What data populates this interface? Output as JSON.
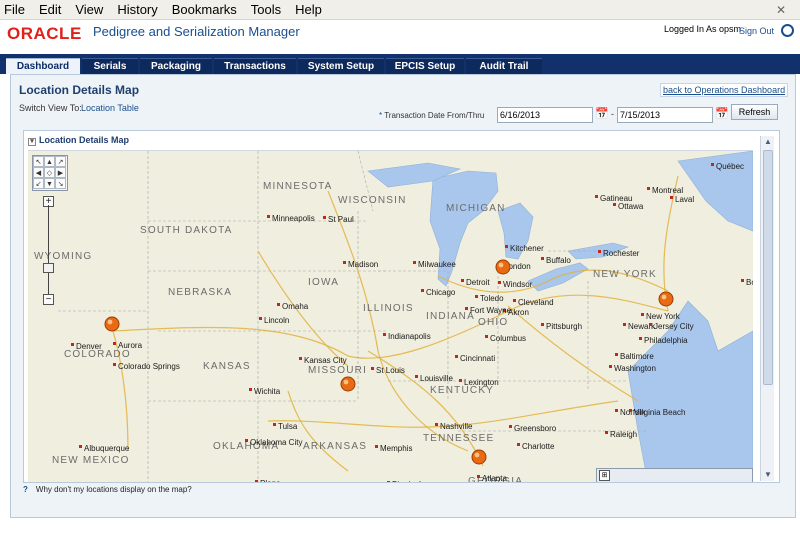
{
  "menubar": {
    "items": [
      "File",
      "Edit",
      "View",
      "History",
      "Bookmarks",
      "Tools",
      "Help"
    ]
  },
  "header": {
    "logo": "ORACLE",
    "app_title": "Pedigree and Serialization Manager",
    "logged_in": "Logged In As opsm",
    "sign_out": "Sign Out"
  },
  "tabs": [
    {
      "label": "Dashboard",
      "active": true
    },
    {
      "label": "Serials",
      "active": false
    },
    {
      "label": "Packaging",
      "active": false
    },
    {
      "label": "Transactions",
      "active": false
    },
    {
      "label": "System Setup",
      "active": false
    },
    {
      "label": "EPCIS Setup",
      "active": false
    },
    {
      "label": "Audit Trail",
      "active": false
    }
  ],
  "page": {
    "title": "Location Details Map",
    "back_link": "back to Operations Dashboard",
    "switch_label": "Switch View To:",
    "switch_link": "Location Table",
    "date_required": "*",
    "date_label": "Transaction Date From/Thru",
    "date_from": "6/16/2013",
    "date_to": "7/15/2013",
    "date_sep": "-",
    "refresh": "Refresh",
    "panel_title": "Location Details Map",
    "help_text": "Why don't my locations display on the map?"
  },
  "map": {
    "labels": [
      {
        "t": "MINNESOTA",
        "c": "region"
      },
      {
        "t": "WISCONSIN",
        "c": "region"
      },
      {
        "t": "MICHIGAN",
        "c": "region"
      },
      {
        "t": "SOUTH DAKOTA",
        "c": "region"
      },
      {
        "t": "WYOMING",
        "c": "region"
      },
      {
        "t": "NEBRASKA",
        "c": "region"
      },
      {
        "t": "IOWA",
        "c": "region"
      },
      {
        "t": "ILLINOIS",
        "c": "region"
      },
      {
        "t": "INDIANA",
        "c": "region"
      },
      {
        "t": "OHIO",
        "c": "region"
      },
      {
        "t": "COLORADO",
        "c": "region"
      },
      {
        "t": "KANSAS",
        "c": "region"
      },
      {
        "t": "MISSOURI",
        "c": "region"
      },
      {
        "t": "KENTUCKY",
        "c": "region"
      },
      {
        "t": "TENNESSEE",
        "c": "region"
      },
      {
        "t": "OKLAHOMA",
        "c": "region"
      },
      {
        "t": "ARKANSAS",
        "c": "region"
      },
      {
        "t": "NEW MEXICO",
        "c": "region"
      },
      {
        "t": "NEW YORK",
        "c": "region"
      },
      {
        "t": "GEORGIA",
        "c": "region"
      },
      {
        "t": "Minneapolis",
        "c": "city"
      },
      {
        "t": "St Paul",
        "c": "city"
      },
      {
        "t": "Madison",
        "c": "city"
      },
      {
        "t": "Milwaukee",
        "c": "city"
      },
      {
        "t": "Chicago",
        "c": "city"
      },
      {
        "t": "Detroit",
        "c": "city"
      },
      {
        "t": "Windsor",
        "c": "city"
      },
      {
        "t": "London",
        "c": "city"
      },
      {
        "t": "Kitchener",
        "c": "city"
      },
      {
        "t": "Buffalo",
        "c": "city"
      },
      {
        "t": "Rochester",
        "c": "city"
      },
      {
        "t": "Toledo",
        "c": "city"
      },
      {
        "t": "Cleveland",
        "c": "city"
      },
      {
        "t": "Akron",
        "c": "city"
      },
      {
        "t": "Fort Wayne",
        "c": "city"
      },
      {
        "t": "Pittsburgh",
        "c": "city"
      },
      {
        "t": "Columbus",
        "c": "city"
      },
      {
        "t": "Indianapolis",
        "c": "city"
      },
      {
        "t": "Cincinnati",
        "c": "city"
      },
      {
        "t": "Omaha",
        "c": "city"
      },
      {
        "t": "Lincoln",
        "c": "city"
      },
      {
        "t": "Denver",
        "c": "city"
      },
      {
        "t": "Aurora",
        "c": "city"
      },
      {
        "t": "Colorado Springs",
        "c": "city"
      },
      {
        "t": "Kansas City",
        "c": "city"
      },
      {
        "t": "St Louis",
        "c": "city"
      },
      {
        "t": "Louisville",
        "c": "city"
      },
      {
        "t": "Lexington",
        "c": "city"
      },
      {
        "t": "Wichita",
        "c": "city"
      },
      {
        "t": "Tulsa",
        "c": "city"
      },
      {
        "t": "Oklahoma City",
        "c": "city"
      },
      {
        "t": "Memphis",
        "c": "city"
      },
      {
        "t": "Nashville",
        "c": "city"
      },
      {
        "t": "Albuquerque",
        "c": "city"
      },
      {
        "t": "Birmingham",
        "c": "city"
      },
      {
        "t": "Atlanta",
        "c": "city"
      },
      {
        "t": "Charlotte",
        "c": "city"
      },
      {
        "t": "Greensboro",
        "c": "city"
      },
      {
        "t": "Raleigh",
        "c": "city"
      },
      {
        "t": "Norfolk",
        "c": "city"
      },
      {
        "t": "Virginia Beach",
        "c": "city"
      },
      {
        "t": "Baltimore",
        "c": "city"
      },
      {
        "t": "Washington",
        "c": "city"
      },
      {
        "t": "Philadelphia",
        "c": "city"
      },
      {
        "t": "New York",
        "c": "city"
      },
      {
        "t": "Newark",
        "c": "city"
      },
      {
        "t": "Jersey City",
        "c": "city"
      },
      {
        "t": "Boston",
        "c": "city"
      },
      {
        "t": "Ottawa",
        "c": "city"
      },
      {
        "t": "Montreal",
        "c": "city"
      },
      {
        "t": "Laval",
        "c": "city"
      },
      {
        "t": "Gatineau",
        "c": "city"
      },
      {
        "t": "Québec",
        "c": "city"
      },
      {
        "t": "Plano",
        "c": "city"
      }
    ],
    "markers": [
      "Denver",
      "St Louis",
      "Detroit",
      "New York",
      "Atlanta"
    ],
    "colors": {
      "land": "#f0eede",
      "water": "#a9c7ec",
      "road": "#e2b23c",
      "border": "#a8a8a8",
      "marker": "#e86a12"
    }
  }
}
